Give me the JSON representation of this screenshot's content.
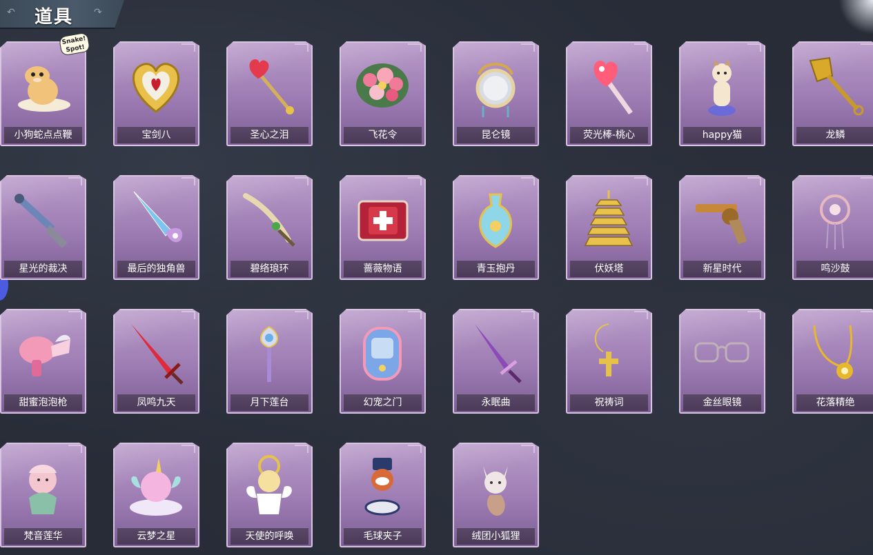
{
  "header": {
    "title": "道具",
    "ornament_left": "↶",
    "ornament_right": "↷"
  },
  "badge_text": "Snake! Spot!",
  "items": [
    {
      "label": "小狗蛇点点鞭",
      "icon": "snake-plush-icon",
      "accent": "#f1c27a"
    },
    {
      "label": "宝剑八",
      "icon": "heart-shield-icon",
      "accent": "#e8c04a"
    },
    {
      "label": "圣心之泪",
      "icon": "heart-scepter-icon",
      "accent": "#e43a4e"
    },
    {
      "label": "飞花令",
      "icon": "flower-bouquet-icon",
      "accent": "#f07a98"
    },
    {
      "label": "昆仑镜",
      "icon": "ornate-mirror-icon",
      "accent": "#e6d3a0"
    },
    {
      "label": "荧光棒-桃心",
      "icon": "glow-wand-icon",
      "accent": "#ff5d7a"
    },
    {
      "label": "happy猫",
      "icon": "dancing-cat-icon",
      "accent": "#f5e6d0"
    },
    {
      "label": "龙鳞",
      "icon": "golden-shovel-icon",
      "accent": "#d9a92c"
    },
    {
      "label": "星光的裁决",
      "icon": "blunderbuss-icon",
      "accent": "#6c86b8"
    },
    {
      "label": "最后的独角兽",
      "icon": "unicorn-horn-icon",
      "accent": "#7ec4f0"
    },
    {
      "label": "碧络琅环",
      "icon": "curved-blade-icon",
      "accent": "#e8d8b0"
    },
    {
      "label": "蔷薇物语",
      "icon": "medkit-icon",
      "accent": "#b32238"
    },
    {
      "label": "青玉抱丹",
      "icon": "jade-vase-icon",
      "accent": "#8fd6e8"
    },
    {
      "label": "伏妖塔",
      "icon": "pagoda-icon",
      "accent": "#e8c24a"
    },
    {
      "label": "新星时代",
      "icon": "revolver-icon",
      "accent": "#c8883a"
    },
    {
      "label": "鸣沙鼓",
      "icon": "dreamcatcher-icon",
      "accent": "#e6b8c0"
    },
    {
      "label": "甜蜜泡泡枪",
      "icon": "bubble-gun-icon",
      "accent": "#f29ab8"
    },
    {
      "label": "凤鸣九天",
      "icon": "red-sword-icon",
      "accent": "#e02a3a"
    },
    {
      "label": "月下莲台",
      "icon": "lotus-scepter-icon",
      "accent": "#a98ad6"
    },
    {
      "label": "幻宠之门",
      "icon": "pet-device-icon",
      "accent": "#7ba6e8"
    },
    {
      "label": "永眠曲",
      "icon": "violet-sword-icon",
      "accent": "#8c4ab8"
    },
    {
      "label": "祝祷词",
      "icon": "cross-necklace-icon",
      "accent": "#e6c24a"
    },
    {
      "label": "金丝眼镜",
      "icon": "glasses-icon",
      "accent": "#c0b0b8"
    },
    {
      "label": "花落精绝",
      "icon": "flower-necklace-icon",
      "accent": "#e8b82c"
    },
    {
      "label": "梵音莲华",
      "icon": "lotus-doll-icon",
      "accent": "#f3c6d0"
    },
    {
      "label": "云梦之星",
      "icon": "unicorn-cloud-icon",
      "accent": "#f4b6e0"
    },
    {
      "label": "天使的呼唤",
      "icon": "angel-doll-icon",
      "accent": "#f6e0a0"
    },
    {
      "label": "毛球夹子",
      "icon": "raccoon-drummer-icon",
      "accent": "#d86a3a"
    },
    {
      "label": "绒团小狐狸",
      "icon": "white-fox-icon",
      "accent": "#f0e6e6"
    }
  ]
}
